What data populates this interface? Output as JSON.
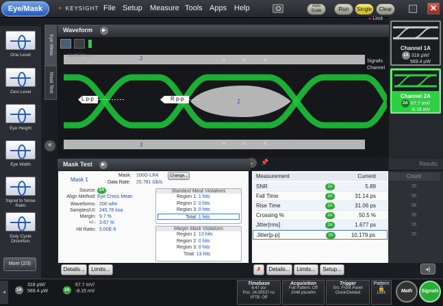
{
  "app": {
    "mode_button": "Eye/Mask",
    "brand": "KEYSIGHT"
  },
  "menu": [
    "File",
    "Setup",
    "Measure",
    "Tools",
    "Apps",
    "Help"
  ],
  "toolbar": {
    "autoscale": "Auto Scale",
    "run": "Run",
    "single": "Single",
    "clear": "Clear",
    "close": "✕"
  },
  "limit_label": "Limit",
  "left_tools": [
    "One Level",
    "Zero Level",
    "Eye Height",
    "Eye Width",
    "Signal to Noise Ratio",
    "Duty Cycle Distortion"
  ],
  "more_button": "More (2/3)",
  "side_tabs": {
    "eye_meas": "Eye Meas",
    "mask_test": "Mask Test"
  },
  "waveform": {
    "title": "Waveform",
    "timestamp": "24.00537 ns",
    "region_top": "2",
    "region_center": "1",
    "region_bottom": "3",
    "marker_left": "L p-p",
    "marker_right": "R p-p",
    "signals_label": "Signals",
    "channel_label": "Channel"
  },
  "channels": [
    {
      "name": "Channel 1A",
      "badge": "1A",
      "power": "318 µW/",
      "offset": "569.4 µW",
      "color": "#8a8a8a"
    },
    {
      "name": "Channel 2A",
      "badge": "2A",
      "power": "67.7 mV/",
      "offset": "-8.15 mV",
      "color": "#2eaa3a"
    }
  ],
  "results_label": "Results",
  "mask_test": {
    "title": "Mask Test",
    "mask_name": "Mask 1",
    "mask_label": "Mask:",
    "mask_value": "100G-LR4",
    "change_button": "Change...",
    "data_rate_label": "Data Rate:",
    "data_rate": "25.781 Gb/s",
    "source_label": "Source:",
    "source_badge": "2A",
    "align_label": "Align Method:",
    "align_value": "Eye Cross Mean",
    "waveforms_label": "Waveforms:",
    "waveforms_value": "200 wfm",
    "samples_label": "Samples/UI:",
    "samples_value": "245.76 ksa",
    "margin_label": "Margin:",
    "margin_value": "9.7 %",
    "plusminus_label": "+/-:",
    "plusminus_value": "3.67 %",
    "hitratio_label": "Hit Ratio:",
    "hitratio_value": "5.00E-5",
    "std_header": "Standard Mask Violations",
    "std_rows": [
      {
        "label": "Region 1:",
        "value": "1 hits"
      },
      {
        "label": "Region 2:",
        "value": "0 hits"
      },
      {
        "label": "Region 3:",
        "value": "0 hits"
      },
      {
        "label": "Total:",
        "value": "1 hits"
      }
    ],
    "margin_header": "Margin Mask Violations",
    "margin_rows": [
      {
        "label": "Region 1:",
        "value": "13 hits"
      },
      {
        "label": "Region 2:",
        "value": "0 hits"
      },
      {
        "label": "Region 3:",
        "value": "0 hits"
      },
      {
        "label": "Total:",
        "value": "13 hits"
      }
    ],
    "details_button": "Details...",
    "limits_button": "Limits..."
  },
  "measurements": {
    "col_measurement": "Measurement",
    "col_current": "Current",
    "col_count": "Count",
    "rows": [
      {
        "name": "SNR",
        "source": "2A",
        "current": "5.89",
        "count": "35"
      },
      {
        "name": "Fall Time",
        "source": "2A",
        "current": "31.14 ps",
        "count": "36"
      },
      {
        "name": "Rise Time",
        "source": "2A",
        "current": "31.06 ps",
        "count": "36"
      },
      {
        "name": "Crossing %",
        "source": "2A",
        "current": "50.5 %",
        "count": "35"
      },
      {
        "name": "Jitter[rms]",
        "source": "2A",
        "current": "1.677 ps",
        "count": "35"
      },
      {
        "name": "Jitter[p-p]",
        "source": "2A",
        "current": "10.179 ps",
        "count": "35"
      }
    ],
    "delete_button": "✗",
    "details_button": "Details...",
    "limits_button": "Limits...",
    "setup_button": "Setup..."
  },
  "status": {
    "ch1_badge": "1A",
    "ch1_power": "318 µW/",
    "ch1_offset": "569.4 µW",
    "ch2_badge": "2A",
    "ch2_power": "67.7 mV/",
    "ch2_offset": "-8.15 mV",
    "timebase_title": "Timebase",
    "timebase_scale": "6.47 ps/",
    "timebase_pos": "Pos: 24.00537 ns",
    "timebase_ipt": "IPTB: Off",
    "acq_title": "Acquisition",
    "acq_pattern": "Full Pattern: Off",
    "acq_pts": "2048 pts/wfm",
    "trig_title": "Trigger",
    "trig_src": "Src: Front Panel",
    "trig_clk": "Clock/Divided",
    "pattern_title": "Pattern",
    "pattern_lock": "Lock",
    "math": "Math",
    "signals": "Signals"
  }
}
